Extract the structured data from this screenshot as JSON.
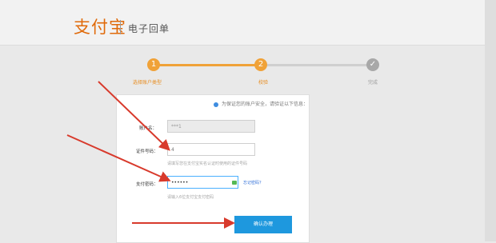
{
  "header": {
    "logo": "支付宝",
    "subtitle": "电子回单"
  },
  "steps": [
    {
      "number": "1",
      "label": "选择账户类型",
      "state": "active"
    },
    {
      "number": "2",
      "label": "校验",
      "state": "active"
    },
    {
      "number": "✓",
      "label": "完成",
      "state": "pending"
    }
  ],
  "form": {
    "notice": "为保证您的账户安全，请验证以下信息：",
    "account_label": "账户名：",
    "account_value": "***1",
    "id_label": "证件号码：",
    "id_value": "4",
    "id_hint": "请填写您在支付宝实名认证时使用的证件号码",
    "password_label": "支付密码：",
    "password_value": "••••••",
    "forgot_link": "忘记密码？",
    "password_hint": "请输入6位支付宝支付密码",
    "confirm": "确认办理"
  },
  "colors": {
    "accent": "#f0a238",
    "primary": "#1e98de",
    "arrow": "#d83a2c"
  }
}
